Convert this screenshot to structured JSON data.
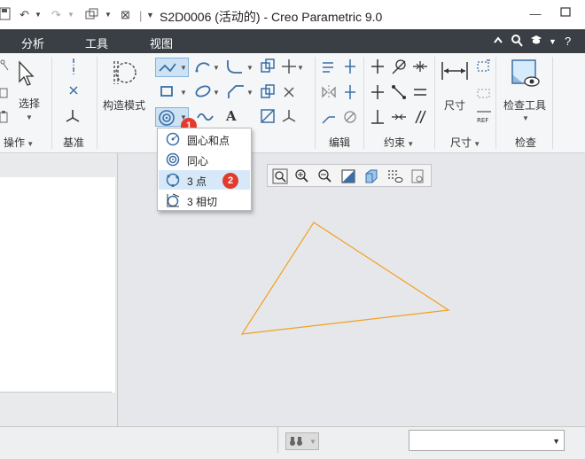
{
  "titlebar": {
    "title": "S2D0006 (活动的) - Creo Parametric 9.0",
    "minimize_icon": "minimize-icon",
    "maximize_icon": "maximize-icon"
  },
  "menu": {
    "items": [
      "分析",
      "工具",
      "视图"
    ]
  },
  "ribbon": {
    "select_label": "选择",
    "operations_group": "操作",
    "datum_group": "基准",
    "construct_mode_label": "构造模式",
    "edit_group": "编辑",
    "constrain_group": "约束",
    "dimension_label": "尺寸",
    "dimension_group": "尺寸",
    "inspect_tool_label": "检查工具",
    "inspect_group": "检查"
  },
  "dropdown": {
    "items": [
      {
        "label": "圆心和点",
        "icon": "circle-center-point-icon"
      },
      {
        "label": "同心",
        "icon": "concentric-circle-icon"
      },
      {
        "label": "3 点",
        "icon": "three-point-circle-icon"
      },
      {
        "label": "3 相切",
        "icon": "three-tangent-circle-icon"
      }
    ],
    "highlighted_index": 2
  },
  "annotations": {
    "badge1": "1",
    "badge2": "2"
  },
  "colors": {
    "menubar": "#3a3f45",
    "sketch_line": "#f0a020",
    "badge": "#e23b2e",
    "highlight": "#d7e9f8"
  },
  "sketch": {
    "shape": "triangle",
    "vertices_px": "drawn as polygon in canvas"
  }
}
